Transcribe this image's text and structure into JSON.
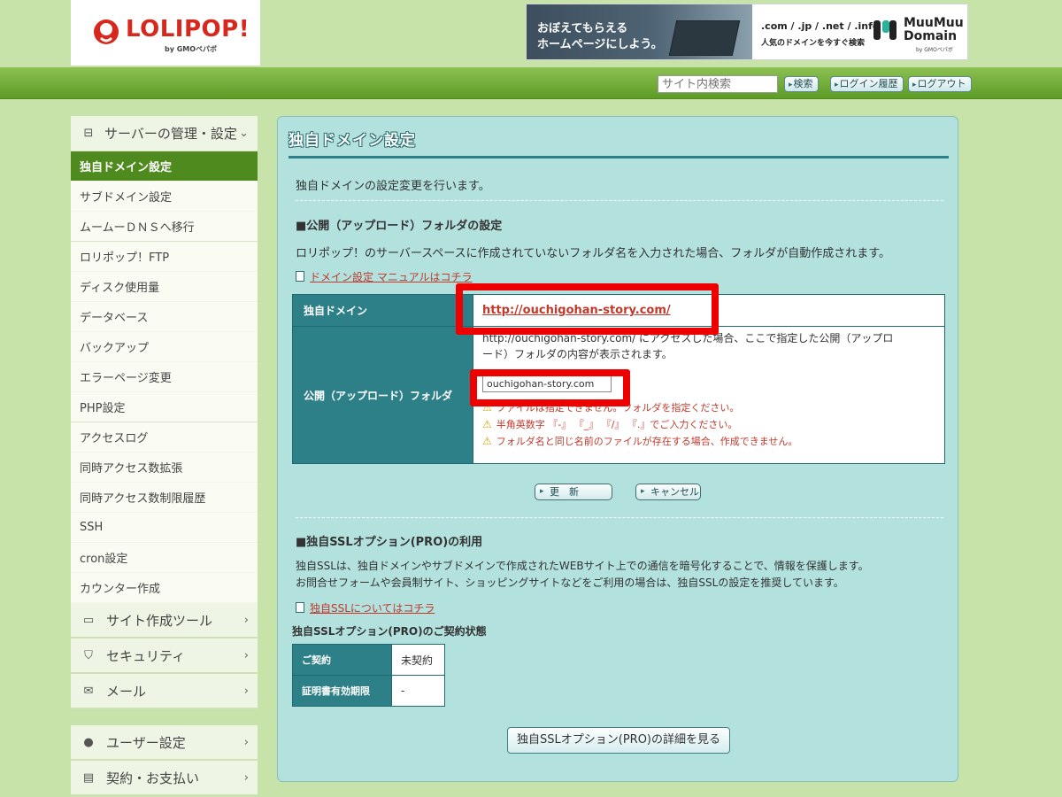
{
  "header": {
    "logo_text": "LOLIPOP!",
    "logo_sub": "by GMOペパボ",
    "banner": {
      "line1": "おぼえてもらえる",
      "line2": "ホームページにしよう。",
      "domains": ".com / .jp / .net / .info",
      "tagline": "人気のドメインを今すぐ検索",
      "brand_line1": "MuuMuu",
      "brand_line2": "Domain",
      "brand_sub": "by GMOペパボ"
    },
    "search_placeholder": "サイト内検索",
    "search_button": "検索",
    "login_history_button": "ログイン履歴",
    "logout_button": "ログアウト"
  },
  "sidebar": {
    "section_title": "サーバーの管理・設定",
    "items": [
      {
        "label": "独自ドメイン設定",
        "active": true
      },
      {
        "label": "サブドメイン設定"
      },
      {
        "label": "ムームーＤＮＳへ移行"
      },
      {
        "label": "ロリポップ！FTP"
      },
      {
        "label": "ディスク使用量"
      },
      {
        "label": "データベース"
      },
      {
        "label": "バックアップ"
      },
      {
        "label": "エラーページ変更"
      },
      {
        "label": "PHP設定"
      },
      {
        "label": "アクセスログ"
      },
      {
        "label": "同時アクセス数拡張"
      },
      {
        "label": "同時アクセス数制限履歴"
      },
      {
        "label": "SSH"
      },
      {
        "label": "cron設定"
      },
      {
        "label": "カウンター作成"
      }
    ],
    "categories": [
      {
        "label": "サイト作成ツール",
        "icon": "laptop-icon"
      },
      {
        "label": "セキュリティ",
        "icon": "shield-icon"
      },
      {
        "label": "メール",
        "icon": "mail-icon"
      },
      {
        "label": "ユーザー設定",
        "icon": "user-icon"
      },
      {
        "label": "契約・お支払い",
        "icon": "card-icon"
      }
    ]
  },
  "main": {
    "title": "独自ドメイン設定",
    "intro": "独自ドメインの設定変更を行います。",
    "folder_section_title": "■公開（アップロード）フォルダの設定",
    "folder_desc": "ロリポップ！のサーバースペースに作成されていないフォルダ名を入力された場合、フォルダが自動作成されます。",
    "manual_link": "ドメイン設定 マニュアルはコチラ",
    "table": {
      "domain_label": "独自ドメイン",
      "domain_value": "http://ouchigohan-story.com/",
      "folder_label": "公開（アップロード）フォルダ",
      "folder_desc_line1": "http://ouchigohan-story.com/ にアクセスした場合、ここで指定した公開（アップロ",
      "folder_desc_line2": "ード）フォルダの内容が表示されます。",
      "folder_value": "ouchigohan-story.com",
      "warnings": [
        "ファイルは指定できません。フォルダを指定ください。",
        "半角英数字 『-』 『_』 『/』 『.』でご入力ください。",
        "フォルダ名と同じ名前のファイルが存在する場合、作成できません。"
      ]
    },
    "update_button": "更　新",
    "cancel_button": "キャンセル",
    "ssl_section_title": "■独自SSLオプション(PRO)の利用",
    "ssl_desc_line1": "独自SSLは、独自ドメインやサブドメインで作成されたWEBサイト上での通信を暗号化することで、情報を保護します。",
    "ssl_desc_line2": "お問合せフォームや会員制サイト、ショッピングサイトなどをご利用の場合は、独自SSLの設定を推奨しています。",
    "ssl_link": "独自SSLについてはコチラ",
    "ssl_status_title": "独自SSLオプション(PRO)のご契約状態",
    "ssl_table": {
      "contract_label": "ご契約",
      "contract_value": "未契約",
      "expiry_label": "証明書有効期限",
      "expiry_value": "-"
    },
    "ssl_detail_button": "独自SSLオプション(PRO)の詳細を見る"
  },
  "colors": {
    "brand_red": "#d8271c",
    "header_green": "#5d9b26",
    "sidebar_active": "#4f8a1e",
    "panel_bg": "#b2e1de",
    "table_header": "#2d8087",
    "highlight_red": "#e00000"
  }
}
